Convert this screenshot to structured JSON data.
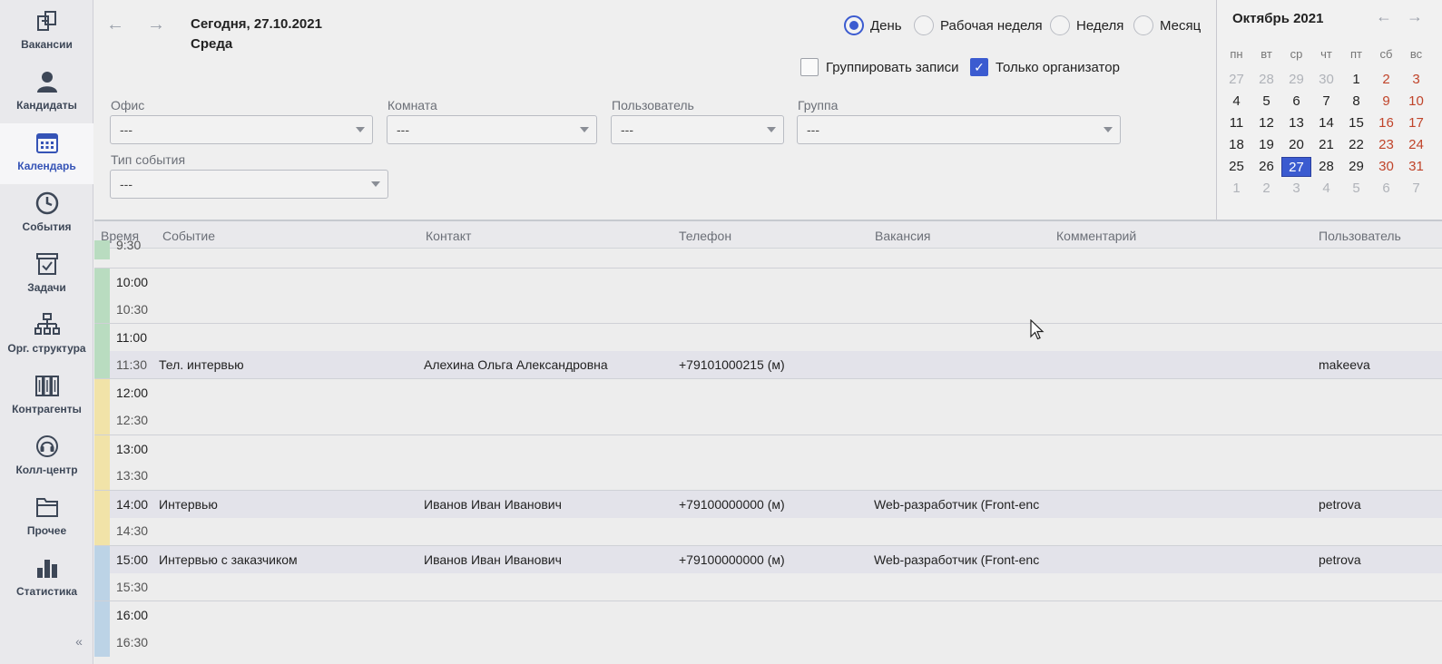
{
  "sidebar": {
    "items": [
      {
        "label": "Вакансии",
        "icon": "vacancies-icon"
      },
      {
        "label": "Кандидаты",
        "icon": "candidates-icon"
      },
      {
        "label": "Календарь",
        "icon": "calendar-icon",
        "active": true
      },
      {
        "label": "События",
        "icon": "clock-icon"
      },
      {
        "label": "Задачи",
        "icon": "tasks-icon"
      },
      {
        "label": "Орг. структура",
        "icon": "org-structure-icon"
      },
      {
        "label": "Контрагенты",
        "icon": "contractors-icon"
      },
      {
        "label": "Колл-центр",
        "icon": "headset-icon"
      },
      {
        "label": "Прочее",
        "icon": "folder-icon"
      },
      {
        "label": "Статистика",
        "icon": "bar-chart-icon"
      }
    ],
    "collapse_glyph": "«"
  },
  "header": {
    "back_glyph": "←",
    "forward_glyph": "→",
    "date_line1": "Сегодня,  27.10.2021",
    "date_line2": "Среда"
  },
  "view_modes": [
    {
      "label": "День",
      "checked": true
    },
    {
      "label": "Рабочая неделя",
      "checked": false
    },
    {
      "label": "Неделя",
      "checked": false
    },
    {
      "label": "Месяц",
      "checked": false
    }
  ],
  "options": {
    "group_label": "Группировать записи",
    "group_checked": false,
    "organizer_label": "Только организатор",
    "organizer_checked": true,
    "check_glyph": "✓"
  },
  "filters": {
    "office": {
      "label": "Офис",
      "value": "---"
    },
    "room": {
      "label": "Комната",
      "value": "---"
    },
    "user": {
      "label": "Пользователь",
      "value": "---"
    },
    "group": {
      "label": "Группа",
      "value": "---"
    },
    "event_type": {
      "label": "Тип события",
      "value": "---"
    }
  },
  "calendar": {
    "title": "Октябрь 2021",
    "prev_glyph": "←",
    "next_glyph": "→",
    "weekdays": [
      "пн",
      "вт",
      "ср",
      "чт",
      "пт",
      "сб",
      "вс"
    ],
    "weeks": [
      [
        "27",
        "28",
        "29",
        "30",
        "1",
        "2",
        "3"
      ],
      [
        "4",
        "5",
        "6",
        "7",
        "8",
        "9",
        "10"
      ],
      [
        "11",
        "12",
        "13",
        "14",
        "15",
        "16",
        "17"
      ],
      [
        "18",
        "19",
        "20",
        "21",
        "22",
        "23",
        "24"
      ],
      [
        "25",
        "26",
        "27",
        "28",
        "29",
        "30",
        "31"
      ],
      [
        "1",
        "2",
        "3",
        "4",
        "5",
        "6",
        "7"
      ]
    ],
    "selected": "27",
    "weekend_color": "#c0442a",
    "accent_color": "#3b5bd0"
  },
  "grid": {
    "columns": [
      "Время",
      "Событие",
      "Контакт",
      "Телефон",
      "Вакансия",
      "Комментарий",
      "Пользователь"
    ],
    "rows": [
      {
        "time": "9:30",
        "stripe": "#b9dcc0",
        "partial": true
      },
      {
        "time": "10:00",
        "stripe": "#b9dcc0"
      },
      {
        "time": "10:30",
        "stripe": "#b9dcc0"
      },
      {
        "time": "11:00",
        "stripe": "#b9dcc0"
      },
      {
        "time": "11:30",
        "stripe": "#b9dcc0",
        "event": "Тел. интервью",
        "contact": "Алехина Ольга Александровна",
        "phone": "+79101000215 (м)",
        "vacancy": "",
        "comment": "",
        "user": "makeeva"
      },
      {
        "time": "12:00",
        "stripe": "#f1e3a8"
      },
      {
        "time": "12:30",
        "stripe": "#f1e3a8"
      },
      {
        "time": "13:00",
        "stripe": "#f1e3a8"
      },
      {
        "time": "13:30",
        "stripe": "#f1e3a8"
      },
      {
        "time": "14:00",
        "stripe": "#f1e3a8",
        "event": "Интервью",
        "contact": "Иванов Иван Иванович",
        "phone": "+79100000000 (м)",
        "vacancy": "Web-разработчик (Front-enc",
        "comment": "",
        "user": "petrova"
      },
      {
        "time": "14:30",
        "stripe": "#f1e3a8"
      },
      {
        "time": "15:00",
        "stripe": "#bcd3e6",
        "event": "Интервью с заказчиком",
        "contact": "Иванов Иван Иванович",
        "phone": "+79100000000 (м)",
        "vacancy": "Web-разработчик (Front-enc",
        "comment": "",
        "user": "petrova"
      },
      {
        "time": "15:30",
        "stripe": "#bcd3e6"
      },
      {
        "time": "16:00",
        "stripe": "#bcd3e6"
      },
      {
        "time": "16:30",
        "stripe": "#bcd3e6"
      }
    ]
  }
}
